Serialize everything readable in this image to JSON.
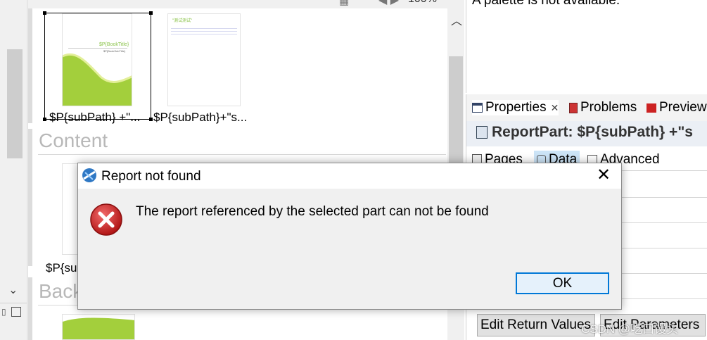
{
  "canvas": {
    "thumb1_caption": "$P{subPath} +\"...",
    "thumb2_caption": "$P{subPath}+\"s...",
    "thumb1_title": "$P{BookTitle}",
    "thumb1_sub": "$P{BookSubTitle}",
    "thumb2_header": "\"测试测试\"",
    "section_content": "Content",
    "section_back": "Back",
    "content_caption_partial": "$P{su"
  },
  "palette": {
    "message": "A palette is not available."
  },
  "zoom": {
    "value": "100%"
  },
  "views": {
    "tabs": [
      {
        "label": "Properties",
        "icon": "properties-icon",
        "active": true
      },
      {
        "label": "Problems",
        "icon": "problems-icon"
      },
      {
        "label": "Preview",
        "icon": "preview-icon"
      }
    ],
    "close_glyph": "✕",
    "header_title": "ReportPart: $P{subPath} +\"s",
    "subtabs": [
      {
        "label": "Pages",
        "icon": "pages-icon"
      },
      {
        "label": "Data",
        "icon": "data-icon",
        "active": true
      },
      {
        "label": "Advanced",
        "icon": "advanced-icon"
      }
    ],
    "buttons": {
      "edit_return_values": "Edit Return Values",
      "edit_parameters": "Edit Parameters"
    }
  },
  "dialog": {
    "title": "Report not found",
    "message": "The report referenced by the selected part can not be found",
    "ok_label": "OK",
    "close_glyph": "✕"
  },
  "watermark": "CSDN @吃口馒头"
}
